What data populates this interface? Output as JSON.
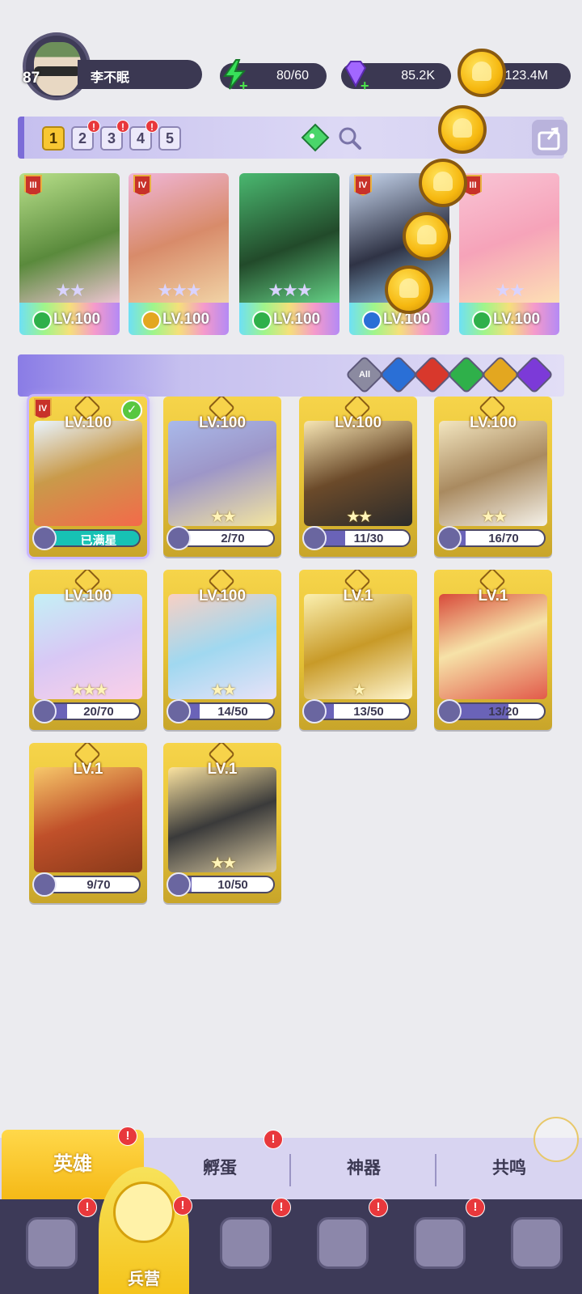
{
  "player": {
    "level": "87",
    "name": "李不眠"
  },
  "resources": {
    "energy": "80/60",
    "gems": "85.2K",
    "gold": "123.4M"
  },
  "team_slots": [
    "1",
    "2",
    "3",
    "4",
    "5"
  ],
  "team_slot_alerts": [
    "",
    "!",
    "!",
    "!",
    ""
  ],
  "team": [
    {
      "tier": "III",
      "level": "LV.100",
      "stars": "★★",
      "element_color": "#2fb04a",
      "art": "linear-gradient(160deg,#b8e08a,#5a8a3c 55%,#f3c7d8)"
    },
    {
      "tier": "IV",
      "level": "LV.100",
      "stars": "★★★",
      "element_color": "#e3a720",
      "art": "linear-gradient(160deg,#f0b6d8,#d88b6a 50%,#f2d6a8)"
    },
    {
      "tier": "",
      "level": "LV.100",
      "stars": "★★★",
      "element_color": "#2fb04a",
      "art": "linear-gradient(160deg,#4ab870,#224a2a 55%,#67d689)"
    },
    {
      "tier": "IV",
      "level": "LV.100",
      "stars": "★★",
      "element_color": "#2a6fd6",
      "art": "linear-gradient(160deg,#c9d8f0,#2f3345 55%,#9ad1f2)"
    },
    {
      "tier": "III",
      "level": "LV.100",
      "stars": "★★",
      "element_color": "#2fb04a",
      "art": "linear-gradient(160deg,#f9c5d6,#f6a3b9 50%,#fde2b4)"
    }
  ],
  "filters": [
    {
      "label": "All",
      "color": "#8b8aa0"
    },
    {
      "label": "",
      "color": "#2a6fd6"
    },
    {
      "label": "",
      "color": "#d8382c"
    },
    {
      "label": "",
      "color": "#2fb04a"
    },
    {
      "label": "",
      "color": "#e3a720"
    },
    {
      "label": "",
      "color": "#7c3ad8"
    }
  ],
  "heroes": [
    {
      "level": "LV.100",
      "progress_text": "已满星",
      "progress": 1.0,
      "full": true,
      "tier": "IV",
      "checked": true,
      "stars": "",
      "art": "linear-gradient(160deg,#e8f4ff,#c99a4a 45%,#f36a4a)"
    },
    {
      "level": "LV.100",
      "progress_text": "2/70",
      "progress": 0.03,
      "full": false,
      "tier": "",
      "checked": false,
      "stars": "★★",
      "art": "linear-gradient(160deg,#a9b9ea,#9d96c8 45%,#f4e6a0)"
    },
    {
      "level": "LV.100",
      "progress_text": "11/30",
      "progress": 0.37,
      "full": false,
      "tier": "",
      "checked": false,
      "stars": "★★",
      "art": "linear-gradient(160deg,#f7e6b4,#6b4a2a 50%,#2b2b2b)"
    },
    {
      "level": "LV.100",
      "progress_text": "16/70",
      "progress": 0.23,
      "full": false,
      "tier": "",
      "checked": false,
      "stars": "★★",
      "art": "linear-gradient(160deg,#f3e6c0,#a98a60 50%,#f5f2ea)"
    },
    {
      "level": "LV.100",
      "progress_text": "20/70",
      "progress": 0.29,
      "full": false,
      "tier": "",
      "checked": false,
      "stars": "★★★",
      "art": "linear-gradient(160deg,#c4f0f5,#d8c8f5 50%,#fbd0e8)"
    },
    {
      "level": "LV.100",
      "progress_text": "14/50",
      "progress": 0.28,
      "full": false,
      "tier": "",
      "checked": false,
      "stars": "★★",
      "art": "linear-gradient(160deg,#f8d0c4,#a0d8f0 50%,#e8e2f8)"
    },
    {
      "level": "LV.1",
      "progress_text": "13/50",
      "progress": 0.26,
      "full": false,
      "tier": "",
      "checked": false,
      "stars": "★",
      "art": "linear-gradient(160deg,#fbf0b0,#c89a28 50%,#fff6cf)"
    },
    {
      "level": "LV.1",
      "progress_text": "13/20",
      "progress": 0.65,
      "full": false,
      "tier": "",
      "checked": false,
      "stars": "",
      "art": "linear-gradient(160deg,#d84a3a,#f6e2a8 45%,#e25a4a)"
    },
    {
      "level": "LV.1",
      "progress_text": "9/70",
      "progress": 0.13,
      "full": false,
      "tier": "",
      "checked": false,
      "stars": "",
      "art": "linear-gradient(160deg,#f7c86a,#c0502a 50%,#8a3a1a)"
    },
    {
      "level": "LV.1",
      "progress_text": "10/50",
      "progress": 0.2,
      "full": false,
      "tier": "",
      "checked": false,
      "stars": "★★",
      "art": "linear-gradient(160deg,#fbe3a0,#3a3a3a 50%,#d8c8a0)"
    }
  ],
  "subtabs": [
    {
      "label": "英雄",
      "alert": "!"
    },
    {
      "label": "孵蛋",
      "alert": "!"
    },
    {
      "label": "神器",
      "alert": ""
    },
    {
      "label": "共鸣",
      "alert": ""
    }
  ],
  "bottom_nav": [
    {
      "label": "",
      "icon": "cards-icon",
      "alert": "!"
    },
    {
      "label": "兵营",
      "icon": "barracks-icon",
      "alert": "!"
    },
    {
      "label": "",
      "icon": "book-icon",
      "alert": "!"
    },
    {
      "label": "",
      "icon": "castle-icon",
      "alert": "!"
    },
    {
      "label": "",
      "icon": "guild-icon",
      "alert": "!"
    },
    {
      "label": "",
      "icon": "banner-icon",
      "alert": ""
    }
  ]
}
